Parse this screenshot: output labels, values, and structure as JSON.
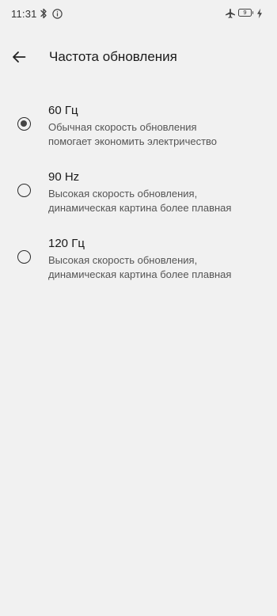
{
  "status_bar": {
    "time": "11:31",
    "battery_level": "9",
    "icons": [
      "bluetooth-icon",
      "info-icon",
      "airplane-mode-icon",
      "battery-icon",
      "charging-bolt-icon"
    ]
  },
  "header": {
    "back_icon": "arrow-left-icon",
    "title": "Частота обновления"
  },
  "refresh_rate_options": [
    {
      "title": "60 Гц",
      "description_lines": [
        "Обычная скорость обновления",
        "помогает экономить электричество"
      ],
      "selected": true
    },
    {
      "title": "90 Hz",
      "description_lines": [
        "Высокая скорость обновления,",
        "динамическая картина более плавная"
      ],
      "selected": false
    },
    {
      "title": "120 Гц",
      "description_lines": [
        "Высокая скорость обновления,",
        "динамическая картина более плавная"
      ],
      "selected": false
    }
  ],
  "colors": {
    "background": "#f1f1f1",
    "text_primary": "#1a1a1a",
    "text_secondary": "#555555"
  }
}
